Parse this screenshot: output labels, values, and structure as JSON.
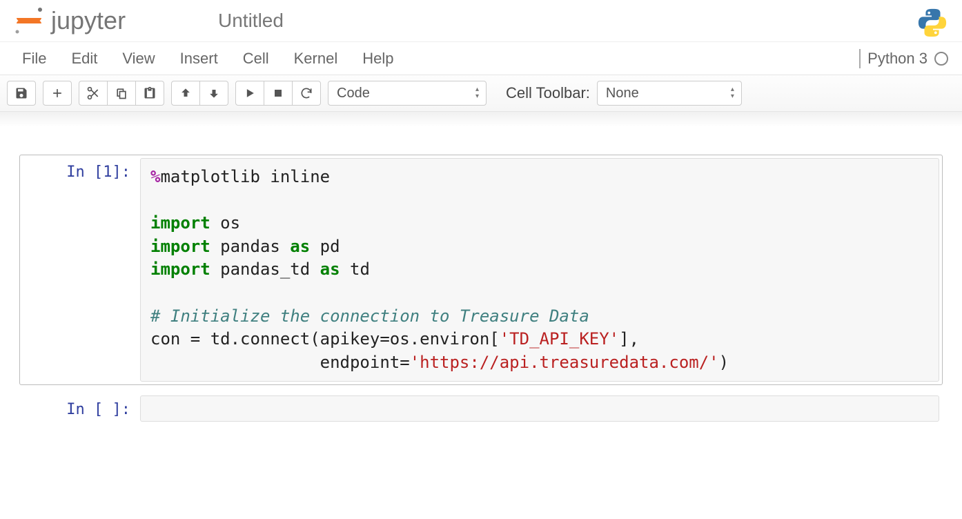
{
  "header": {
    "logo_text": "jupyter",
    "title": "Untitled"
  },
  "menubar": {
    "items": [
      "File",
      "Edit",
      "View",
      "Insert",
      "Cell",
      "Kernel",
      "Help"
    ],
    "kernel_name": "Python 3"
  },
  "toolbar": {
    "cell_type_selected": "Code",
    "cell_toolbar_label": "Cell Toolbar:",
    "cell_toolbar_selected": "None",
    "icons": {
      "save": "save-icon",
      "add": "plus-icon",
      "cut": "scissors-icon",
      "copy": "copy-icon",
      "paste": "paste-icon",
      "up": "arrow-up-icon",
      "down": "arrow-down-icon",
      "run": "play-icon",
      "stop": "stop-icon",
      "restart": "refresh-icon"
    }
  },
  "cells": [
    {
      "prompt": "In [1]:",
      "selected": true,
      "source_tokens": [
        {
          "t": "magic",
          "v": "%"
        },
        {
          "t": "",
          "v": "matplotlib inline"
        },
        {
          "t": "nl"
        },
        {
          "t": "nl"
        },
        {
          "t": "keyword",
          "v": "import"
        },
        {
          "t": "",
          "v": " os"
        },
        {
          "t": "nl"
        },
        {
          "t": "keyword",
          "v": "import"
        },
        {
          "t": "",
          "v": " pandas "
        },
        {
          "t": "as",
          "v": "as"
        },
        {
          "t": "",
          "v": " pd"
        },
        {
          "t": "nl"
        },
        {
          "t": "keyword",
          "v": "import"
        },
        {
          "t": "",
          "v": " pandas_td "
        },
        {
          "t": "as",
          "v": "as"
        },
        {
          "t": "",
          "v": " td"
        },
        {
          "t": "nl"
        },
        {
          "t": "nl"
        },
        {
          "t": "comment",
          "v": "# Initialize the connection to Treasure Data"
        },
        {
          "t": "nl"
        },
        {
          "t": "",
          "v": "con = td.connect(apikey=os.environ["
        },
        {
          "t": "string",
          "v": "'TD_API_KEY'"
        },
        {
          "t": "",
          "v": "],"
        },
        {
          "t": "nl"
        },
        {
          "t": "",
          "v": "                 endpoint="
        },
        {
          "t": "string",
          "v": "'https://api.treasuredata.com/'"
        },
        {
          "t": "",
          "v": ")"
        }
      ]
    },
    {
      "prompt": "In [ ]:",
      "selected": false,
      "source_tokens": []
    }
  ]
}
